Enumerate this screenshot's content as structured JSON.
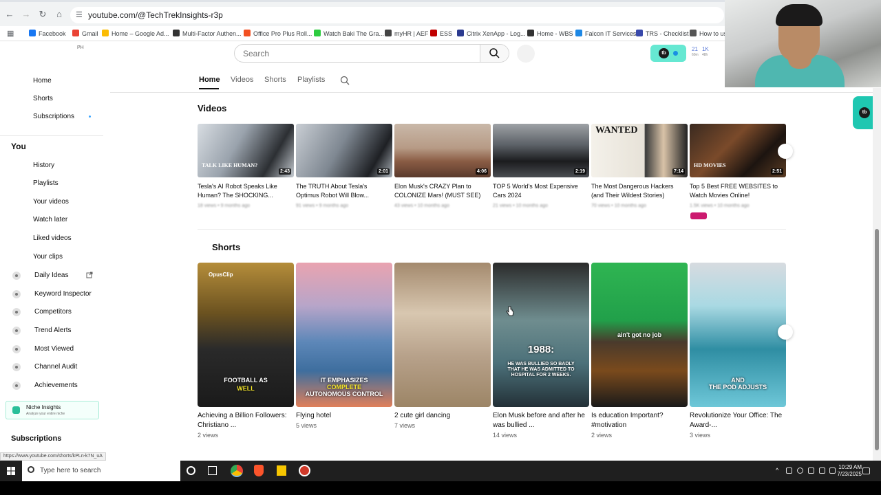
{
  "browser": {
    "url": "youtube.com/@TechTrekInsights-r3p",
    "bookmarks": [
      {
        "label": "Facebook",
        "color": "#1877f2"
      },
      {
        "label": "Gmail",
        "color": "#ea4335"
      },
      {
        "label": "Home – Google Ad...",
        "color": "#fbbc04"
      },
      {
        "label": "Multi-Factor Authen...",
        "color": "#333333"
      },
      {
        "label": "Office Pro Plus Roll...",
        "color": "#f25022"
      },
      {
        "label": "Watch Baki The Gra...",
        "color": "#2ecc40"
      },
      {
        "label": "myHR | AEF",
        "color": "#444444"
      },
      {
        "label": "ESS",
        "color": "#c00000"
      },
      {
        "label": "Citrix XenApp - Log...",
        "color": "#2b3a8f"
      },
      {
        "label": "Home - WBS",
        "color": "#333333"
      },
      {
        "label": "Falcon IT Services",
        "color": "#1e88e5"
      },
      {
        "label": "TRS - Checklist",
        "color": "#3949ab"
      },
      {
        "label": "How to us",
        "color": "#555555"
      }
    ]
  },
  "header": {
    "region_label": "PH",
    "search_placeholder": "Search",
    "ext_logo": "tb",
    "stats": [
      {
        "value": "21",
        "sub": "60m"
      },
      {
        "value": "1K",
        "sub": "48h"
      }
    ]
  },
  "sidebar": {
    "items": [
      {
        "label": "Home"
      },
      {
        "label": "Shorts"
      },
      {
        "label": "Subscriptions"
      }
    ],
    "you_title": "You",
    "you_items": [
      {
        "label": "History"
      },
      {
        "label": "Playlists"
      },
      {
        "label": "Your videos"
      },
      {
        "label": "Watch later"
      },
      {
        "label": "Liked videos"
      },
      {
        "label": "Your clips"
      }
    ],
    "tools": [
      {
        "label": "Daily Ideas"
      },
      {
        "label": "Keyword Inspector"
      },
      {
        "label": "Competitors"
      },
      {
        "label": "Trend Alerts"
      },
      {
        "label": "Most Viewed"
      },
      {
        "label": "Channel Audit"
      },
      {
        "label": "Achievements"
      }
    ],
    "niche": {
      "title": "Niche Insights",
      "subtitle": "Analyze your entire niche"
    },
    "subscriptions_title": "Subscriptions"
  },
  "status_url": "https://www.youtube.com/shorts/kPLn-k7N_uA",
  "channel_tabs": [
    {
      "label": "Home",
      "active": true
    },
    {
      "label": "Videos",
      "active": false
    },
    {
      "label": "Shorts",
      "active": false
    },
    {
      "label": "Playlists",
      "active": false
    }
  ],
  "videos_section": {
    "title": "Videos",
    "items": [
      {
        "title": "Tesla's AI Robot Speaks Like Human? The SHOCKING...",
        "duration": "2:43",
        "meta": "18 views • 9 months ago",
        "thumb_text": "TALK LIKE HUMAN?"
      },
      {
        "title": "The TRUTH About Tesla's Optimus Robot Will Blow...",
        "duration": "2:01",
        "meta": "91 views • 9 months ago",
        "thumb_text": ""
      },
      {
        "title": "Elon Musk's CRAZY Plan to COLONIZE Mars! (MUST SEE)",
        "duration": "4:06",
        "meta": "43 views • 10 months ago",
        "thumb_text": ""
      },
      {
        "title": "TOP 5 World's Most Expensive Cars 2024",
        "duration": "2:19",
        "meta": "21 views • 10 months ago",
        "thumb_text": ""
      },
      {
        "title": "The Most Dangerous Hackers (and Their Wildest Stories)",
        "duration": "7:14",
        "meta": "70 views • 10 months ago",
        "thumb_text": "WANTED"
      },
      {
        "title": "Top 5 Best FREE WEBSITES to Watch Movies Online!",
        "duration": "2:51",
        "meta": "1.5K views • 10 months ago",
        "thumb_text": "HD MOVIES"
      }
    ]
  },
  "shorts_section": {
    "title": "Shorts",
    "items": [
      {
        "title": "Achieving a Billion Followers: Christiano ...",
        "views": "2 views",
        "caption": "FOOTBALL AS",
        "caption_hl": "WELL",
        "brand": "OpusClip"
      },
      {
        "title": "Flying hotel",
        "views": "5 views",
        "caption": "IT EMPHASIZES",
        "caption_hl": "COMPLETE",
        "caption2": "AUTONOMOUS CONTROL"
      },
      {
        "title": "2 cute girl dancing",
        "views": "7 views",
        "caption": "",
        "caption_hl": ""
      },
      {
        "title": "Elon Musk before and after he was bullied ...",
        "views": "14 views",
        "caption": "1988:",
        "caption_hl": "",
        "caption2": "HE WAS BULLIED SO BADLY THAT HE WAS ADMITTED TO HOSPITAL FOR 2 WEEKS."
      },
      {
        "title": "Is education Important? #motivation",
        "views": "2 views",
        "caption": "ain't got no job",
        "caption_hl": ""
      },
      {
        "title": "Revolutionize Your Office: The Award-...",
        "views": "3 views",
        "caption": "AND",
        "caption_hl": "",
        "caption2": "THE POD ADJUSTS"
      }
    ]
  },
  "taskbar": {
    "search_placeholder": "Type here to search",
    "time": "10:29 AM",
    "date": "7/23/2025"
  }
}
